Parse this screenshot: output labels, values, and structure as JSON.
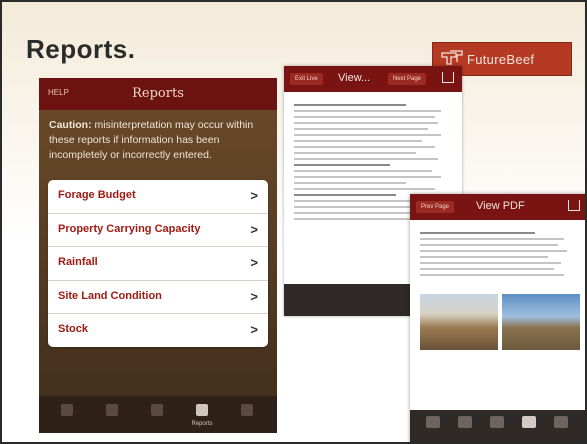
{
  "slide": {
    "title": "Reports."
  },
  "logo": {
    "text": "FutureBeef",
    "color": "#b53a24"
  },
  "phone": {
    "help_label": "HELP",
    "title": "Reports",
    "caution_label": "Caution:",
    "caution_text": "misinterpretation may occur within these reports if information has been incompletely or incorrectly entered.",
    "items": [
      {
        "label": "Forage Budget",
        "chevron": ">"
      },
      {
        "label": "Property Carrying Capacity",
        "chevron": ">"
      },
      {
        "label": "Rainfall",
        "chevron": ">"
      },
      {
        "label": "Site Land Condition",
        "chevron": ">"
      },
      {
        "label": "Stock",
        "chevron": ">"
      }
    ],
    "tabs": [
      {
        "icon": "home-icon"
      },
      {
        "icon": "tools-icon"
      },
      {
        "icon": "document-icon"
      },
      {
        "icon": "reports-icon",
        "label": "Reports",
        "active": true
      },
      {
        "icon": "more-icon"
      }
    ]
  },
  "view_screen": {
    "left_button": "Exit Live",
    "title": "View...",
    "right_button": "Next Page",
    "share_icon": "share-icon"
  },
  "pdf_screen": {
    "left_button": "Prev Page",
    "title": "View PDF",
    "share_icon": "share-icon"
  },
  "colors": {
    "accent": "#7a1412",
    "item_text": "#a01a12",
    "phone_bg": "#5b3f24"
  }
}
